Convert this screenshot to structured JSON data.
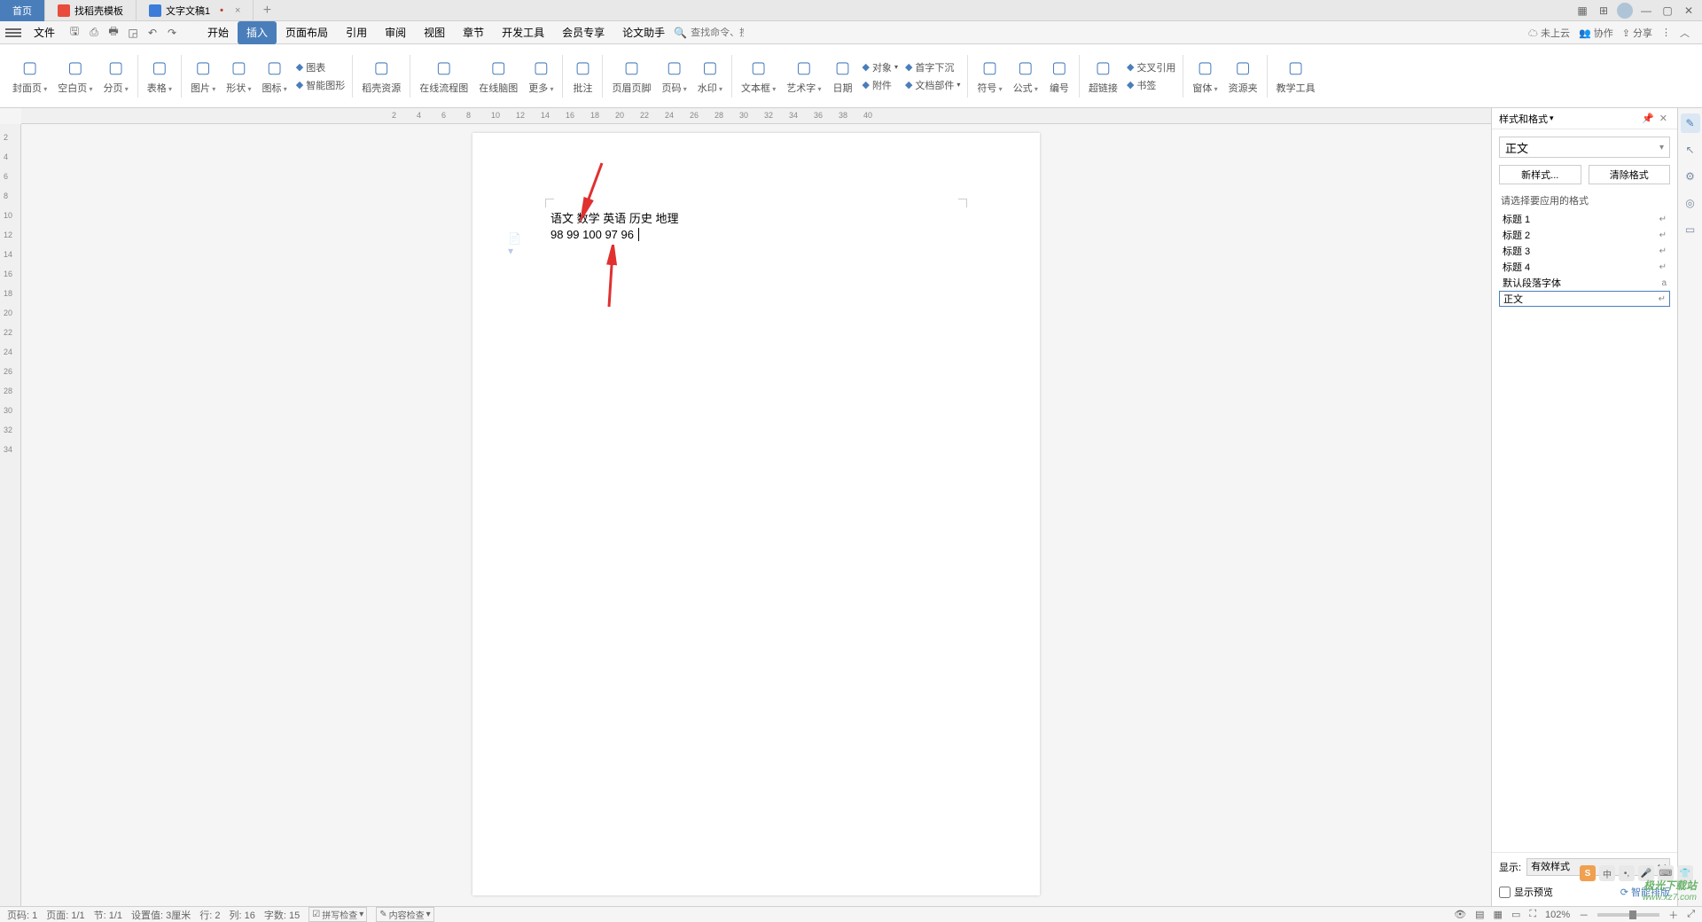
{
  "titlebar": {
    "home_tab": "首页",
    "tab1": "找稻壳模板",
    "tab2": "文字文稿1"
  },
  "menubar": {
    "filemenu": "文件",
    "tabs": [
      "开始",
      "插入",
      "页面布局",
      "引用",
      "审阅",
      "视图",
      "章节",
      "开发工具",
      "会员专享",
      "论文助手"
    ],
    "active_index": 1,
    "search_placeholder": "查找命令、搜索模板",
    "right": {
      "cloud": "未上云",
      "coop": "协作",
      "share": "分享"
    }
  },
  "ribbon": [
    {
      "label": "封面页",
      "dd": true
    },
    {
      "label": "空白页",
      "dd": true
    },
    {
      "label": "分页",
      "dd": true
    },
    {
      "sep": true
    },
    {
      "label": "表格",
      "dd": true
    },
    {
      "sep": true
    },
    {
      "label": "图片",
      "dd": true
    },
    {
      "label": "形状",
      "dd": true
    },
    {
      "label": "图标",
      "dd": true
    },
    {
      "col": [
        {
          "label": "图表"
        },
        {
          "label": "智能图形"
        }
      ]
    },
    {
      "sep": true
    },
    {
      "label": "稻壳资源"
    },
    {
      "sep": true
    },
    {
      "label": "在线流程图"
    },
    {
      "label": "在线脑图"
    },
    {
      "label": "更多",
      "dd": true
    },
    {
      "sep": true
    },
    {
      "label": "批注"
    },
    {
      "sep": true
    },
    {
      "label": "页眉页脚"
    },
    {
      "label": "页码",
      "dd": true
    },
    {
      "label": "水印",
      "dd": true
    },
    {
      "sep": true
    },
    {
      "label": "文本框",
      "dd": true
    },
    {
      "label": "艺术字",
      "dd": true
    },
    {
      "label": "日期"
    },
    {
      "col": [
        {
          "label": "对象",
          "dd": true
        },
        {
          "label": "附件"
        }
      ]
    },
    {
      "col": [
        {
          "label": "首字下沉"
        },
        {
          "label": "文档部件",
          "dd": true
        }
      ]
    },
    {
      "sep": true
    },
    {
      "label": "符号",
      "dd": true
    },
    {
      "label": "公式",
      "dd": true
    },
    {
      "label": "编号"
    },
    {
      "sep": true
    },
    {
      "label": "超链接"
    },
    {
      "col": [
        {
          "label": "交叉引用"
        },
        {
          "label": "书签"
        }
      ]
    },
    {
      "sep": true
    },
    {
      "label": "窗体",
      "dd": true
    },
    {
      "label": "资源夹"
    },
    {
      "sep": true
    },
    {
      "label": "教学工具"
    }
  ],
  "document": {
    "line1": "语文  数学  英语  历史  地理",
    "line2": "98 99 100 97 96"
  },
  "styles_panel": {
    "title": "样式和格式",
    "current": "正文",
    "btn_new": "新样式...",
    "btn_clear": "清除格式",
    "list_label": "请选择要应用的格式",
    "items": [
      "标题 1",
      "标题 2",
      "标题 3",
      "标题 4",
      "默认段落字体",
      "正文"
    ],
    "selected_index": 5,
    "show_label": "显示:",
    "show_value": "有效样式",
    "preview": "显示预览",
    "smart": "智能排版"
  },
  "status": {
    "page_no": "页码: 1",
    "page": "页面: 1/1",
    "section": "节: 1/1",
    "indent": "设置值: 3厘米",
    "row": "行: 2",
    "col": "列: 16",
    "chars": "字数: 15",
    "spell": "拼写检查",
    "content": "内容检查",
    "zoom": "102%"
  },
  "watermark": {
    "t": "极光下载站",
    "s": "www.xz7.com"
  },
  "ruler_ticks": [
    2,
    4,
    6,
    8,
    10,
    12,
    14,
    16,
    18,
    20,
    22,
    24,
    26,
    28,
    30,
    32,
    34,
    36,
    38,
    40
  ],
  "vruler_ticks": [
    2,
    4,
    6,
    8,
    10,
    12,
    14,
    16,
    18,
    20,
    22,
    24,
    26,
    28,
    30,
    32,
    34
  ]
}
